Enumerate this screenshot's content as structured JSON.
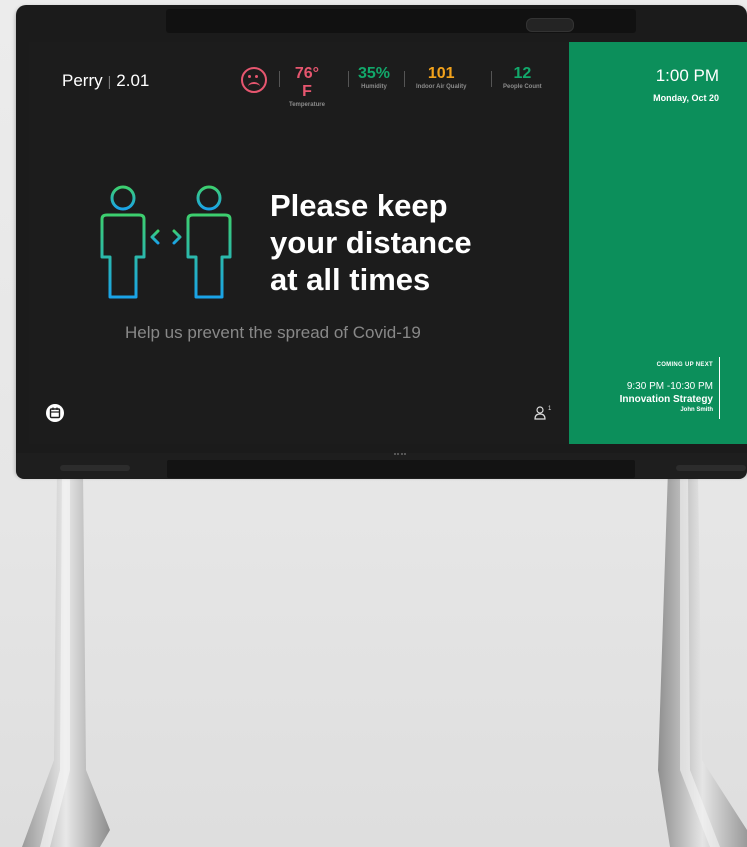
{
  "room": {
    "name": "Perry",
    "number": "2.01"
  },
  "sensors": {
    "status_icon": "sad-face-icon",
    "temperature": {
      "value": "76° F",
      "label": "Temperature",
      "color": "#e6566f"
    },
    "humidity": {
      "value": "35%",
      "label": "Humidity",
      "color": "#12a86b"
    },
    "air_quality": {
      "value": "101",
      "label": "Indoor Air Quality",
      "color": "#f2a21b"
    },
    "people_count": {
      "value": "12",
      "label": "People Count",
      "color": "#12a86b"
    }
  },
  "clock": {
    "time": "1:00 PM",
    "date": "Monday, Oct 20"
  },
  "message": {
    "line1": "Please keep",
    "line2": "your distance",
    "line3": "at all times",
    "subtitle": "Help us prevent the spread of Covid-19"
  },
  "upcoming": {
    "label": "COMING UP NEXT",
    "time": "9:30 PM -10:30 PM",
    "title": "Innovation Strategy",
    "host": "John Smith"
  },
  "footer": {
    "calendar_icon": "calendar-icon",
    "occupancy_icon": "person-icon",
    "occupancy": "1"
  },
  "colors": {
    "panel_bg": "#1c1c1c",
    "side_panel": "#0c8f5b"
  }
}
